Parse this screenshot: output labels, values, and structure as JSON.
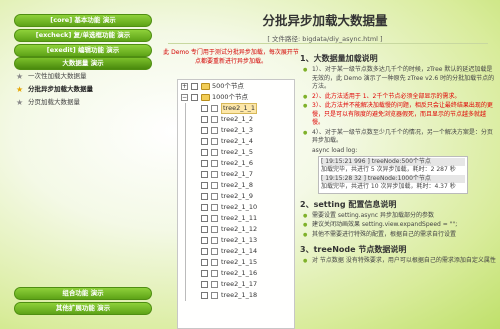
{
  "sidebar": {
    "nav_top": [
      "[core] 基本功能 演示",
      "[excheck] 复/单选框功能 演示",
      "[exedit] 编辑功能 演示",
      "大数据量 演示"
    ],
    "sub_items": [
      "一次性加载大数据量",
      "分批异步加载大数据量",
      "分页加载大数据量"
    ],
    "nav_bottom": [
      "组合功能 演示",
      "其他扩展功能 演示"
    ]
  },
  "header": {
    "title": "分批异步加载大数据量",
    "filepath": "[ 文件路径: bigdata/diy_async.html ]"
  },
  "demo": {
    "note": "此 Demo 专门用于测试分批异步加载，每次展开节点都要重新进行异步加载。",
    "tree": {
      "root1": "500个节点",
      "root2": "1000个节点",
      "children": [
        "tree2_1_1",
        "tree2_1_2",
        "tree2_1_3",
        "tree2_1_4",
        "tree2_1_5",
        "tree2_1_6",
        "tree2_1_7",
        "tree2_1_8",
        "tree2_1_9",
        "tree2_1_10",
        "tree2_1_11",
        "tree2_1_12",
        "tree2_1_13",
        "tree2_1_14",
        "tree2_1_15",
        "tree2_1_16",
        "tree2_1_17",
        "tree2_1_18"
      ],
      "toggle_expanded": "−",
      "toggle_collapsed": "+"
    }
  },
  "explain": {
    "sec1": {
      "num": "1、",
      "title": "大数据量加载说明",
      "items": [
        "1）、对于某一级节点数多达几千个的时候，zTree 默认的延迟加载是无效的，此 Demo 演示了一种原先 zTree v2.6 时的分批加载节点的方法。",
        "2）、此方法适用于 1、2千个节点必须全部显示的需求。",
        "3）、此方法并不能解决加载慢的问题，相反只会让最终结果出现的更慢，只是可以有限度的避免浏览器假死，而且显示的节点越多就越慢。",
        "4）、对于某一级节点数至少几千个的情况，另一个解决方案是：分页异步加载。"
      ],
      "log_label": "async load log:",
      "logs": [
        "[ 19:15:21 996 ]  treeNode:500个节点",
        "加载完毕，共进行 5 次异步加载，耗时：2 287 秒",
        "[ 19:15:28 32 ]  treeNode:1000个节点",
        "加载完毕，共进行 10 次异步加载，耗时：4.37 秒"
      ]
    },
    "sec2": {
      "num": "2、",
      "title": "setting 配置信息说明",
      "items": [
        "需要设置 setting.async 异步加载部分的参数",
        "建议关闭动画效果 setting.view.expandSpeed = \"\";",
        "其他不需要进行特殊的配置，根据自己的需求自行设置"
      ]
    },
    "sec3": {
      "num": "3、",
      "title": "treeNode 节点数据说明",
      "items": [
        "对 节点数据 没有特殊要求，用户可以根据自己的需求添加自定义属性"
      ]
    }
  },
  "colors": {
    "nav_green": "#6cb520",
    "accent_red": "#e00000",
    "selected_node": "#fde7a8"
  }
}
